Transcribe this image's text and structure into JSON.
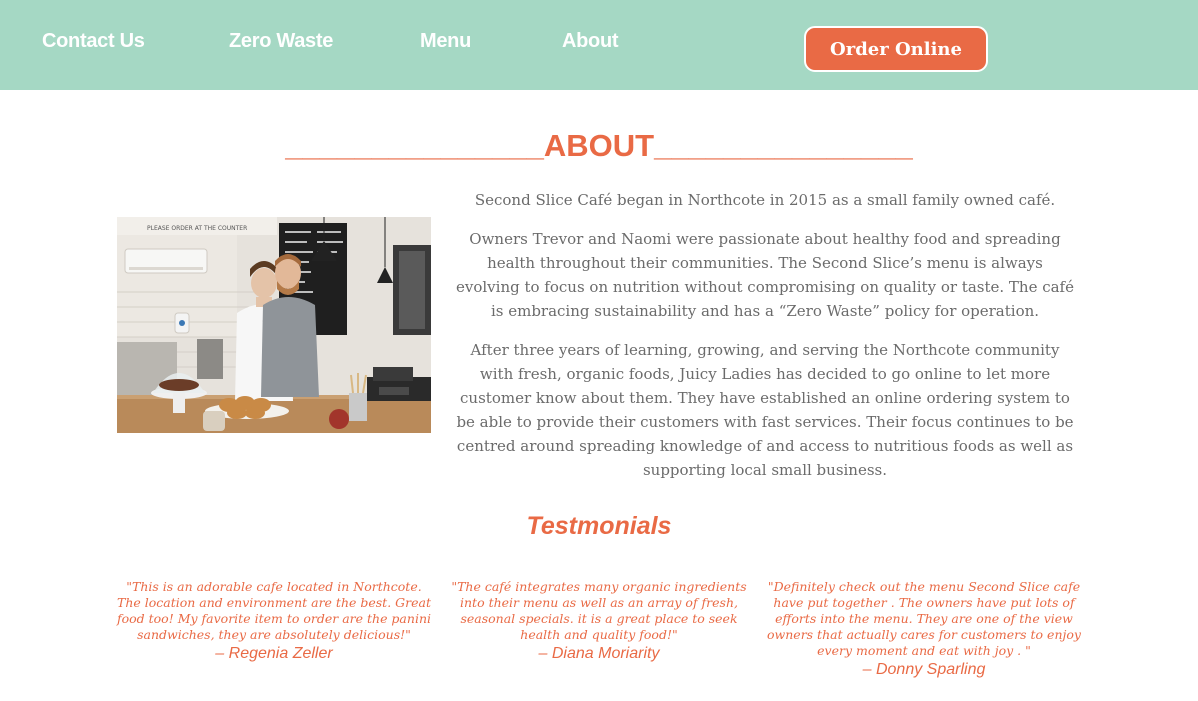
{
  "nav": {
    "links": [
      "Contact Us",
      "Zero Waste",
      "Menu",
      "About"
    ],
    "order_button": "Order Online"
  },
  "about": {
    "heading": "_______________ABOUT_______________",
    "paragraphs": [
      "Second Slice Café began in Northcote in 2015 as a small family owned café.",
      "Owners Trevor and Naomi were passionate about healthy food and spreading health throughout their communities. The Second Slice’s menu is always evolving to focus on nutrition without compromising on quality or taste. The café is embracing sustainability and has a “Zero Waste” policy for operation.",
      "After three years of learning, growing, and serving the Northcote community with fresh, organic foods, Juicy Ladies has decided to go online to let more customer know about them. They have established an online ordering system to be able to provide their customers with fast services. Their focus continues to be centred around spreading knowledge of and access to nutritious foods as well as supporting local small business."
    ],
    "photo_board_text": "PLEASE ORDER AT THE COUNTER"
  },
  "testimonials": {
    "heading": "Testmonials",
    "items": [
      {
        "quote": "\"This is an adorable cafe located in Northcote. The location and environment are the best. Great food too! My favorite item to order are the panini sandwiches, they are absolutely delicious!\"",
        "author": "– Regenia Zeller"
      },
      {
        "quote": "\"The café integrates many organic ingredients into their menu as well as an array of fresh, seasonal specials. it is a great place to seek health and quality food!\"",
        "author": "– Diana Moriarity"
      },
      {
        "quote": "\"Definitely check out the menu Second Slice cafe have put together . The owners have put lots of efforts into the menu. They are one of the view owners that actually cares for customers to enjoy every moment and eat with joy . \"",
        "author": "– Donny Sparling"
      }
    ]
  },
  "colors": {
    "nav_background": "#a5d8c4",
    "accent": "#e96a45",
    "body_text": "#6b6b6b"
  }
}
